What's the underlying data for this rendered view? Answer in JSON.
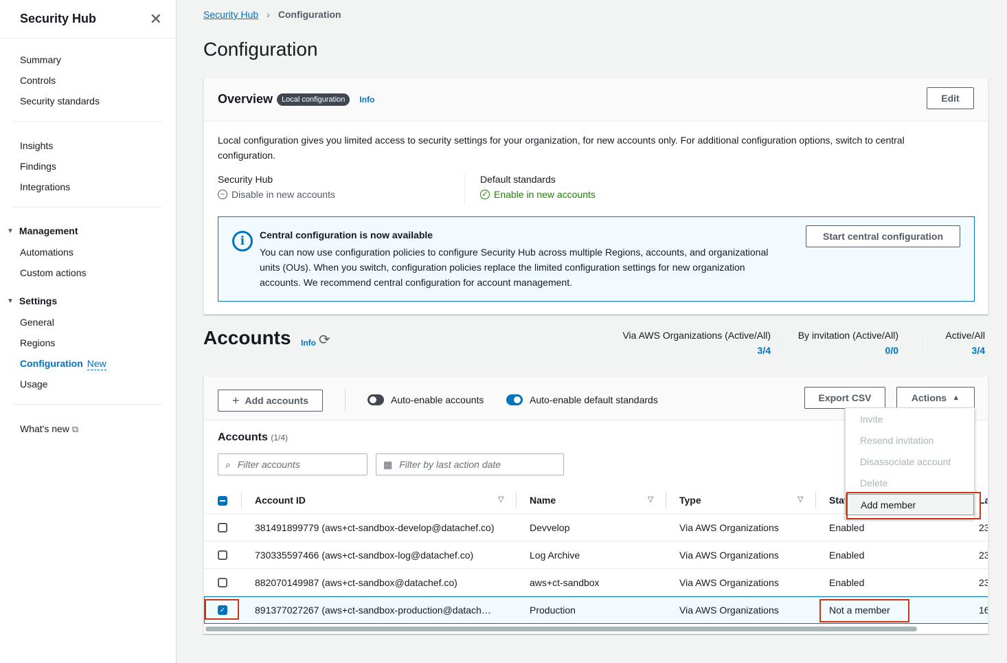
{
  "sidebar": {
    "title": "Security Hub",
    "group1": [
      "Summary",
      "Controls",
      "Security standards"
    ],
    "group2": [
      "Insights",
      "Findings",
      "Integrations"
    ],
    "management": {
      "label": "Management",
      "items": [
        "Automations",
        "Custom actions"
      ]
    },
    "settings": {
      "label": "Settings",
      "items": [
        "General",
        "Regions",
        "Configuration",
        "Usage"
      ],
      "new_badge": "New"
    },
    "whats_new": "What's new"
  },
  "breadcrumb": {
    "root": "Security Hub",
    "current": "Configuration"
  },
  "page_title": "Configuration",
  "overview": {
    "title": "Overview",
    "badge": "Local configuration",
    "info": "Info",
    "edit": "Edit",
    "description": "Local configuration gives you limited access to security settings for your organization, for new accounts only. For additional configuration options, switch to central configuration.",
    "security_hub_label": "Security Hub",
    "security_hub_value": "Disable in new accounts",
    "default_standards_label": "Default standards",
    "default_standards_value": "Enable in new accounts",
    "alert": {
      "title": "Central configuration is now available",
      "body": "You can now use configuration policies to configure Security Hub across multiple Regions, accounts, and organizational units (OUs). When you switch, configuration policies replace the limited configuration settings for new organization accounts. We recommend central configuration for account management.",
      "button": "Start central configuration"
    }
  },
  "accounts": {
    "title": "Accounts",
    "info": "Info",
    "stats": [
      {
        "label": "Via AWS Organizations (Active/All)",
        "value": "3/4"
      },
      {
        "label": "By invitation (Active/All)",
        "value": "0/0"
      },
      {
        "label": "Active/All",
        "value": "3/4"
      }
    ],
    "toolbar": {
      "add": "Add accounts",
      "auto_enable_accounts": "Auto-enable accounts",
      "auto_enable_accounts_on": false,
      "auto_enable_standards": "Auto-enable default standards",
      "auto_enable_standards_on": true,
      "export": "Export CSV",
      "actions": "Actions"
    },
    "list_title": "Accounts",
    "list_count": "(1/4)",
    "filter_placeholder": "Filter accounts",
    "date_placeholder": "Filter by last action date",
    "columns": [
      "Account ID",
      "Name",
      "Type",
      "Stat",
      "La"
    ],
    "rows": [
      {
        "id": "381491899779 (aws+ct-sandbox-develop@datachef.co)",
        "name": "Devvelop",
        "type": "Via AWS Organizations",
        "status": "Enabled",
        "last": "23",
        "checked": false
      },
      {
        "id": "730335597466 (aws+ct-sandbox-log@datachef.co)",
        "name": "Log Archive",
        "type": "Via AWS Organizations",
        "status": "Enabled",
        "last": "23",
        "checked": false
      },
      {
        "id": "882070149987 (aws+ct-sandbox@datachef.co)",
        "name": "aws+ct-sandbox",
        "type": "Via AWS Organizations",
        "status": "Enabled",
        "last": "23",
        "checked": false
      },
      {
        "id": "891377027267 (aws+ct-sandbox-production@datach…",
        "name": "Production",
        "type": "Via AWS Organizations",
        "status": "Not a member",
        "last": "16",
        "checked": true
      }
    ],
    "actions_menu": [
      "Invite",
      "Resend invitation",
      "Disassociate account",
      "Delete",
      "Add member"
    ]
  },
  "colors": {
    "accent": "#0073bb",
    "highlight": "#d13212",
    "success": "#1d8102"
  }
}
